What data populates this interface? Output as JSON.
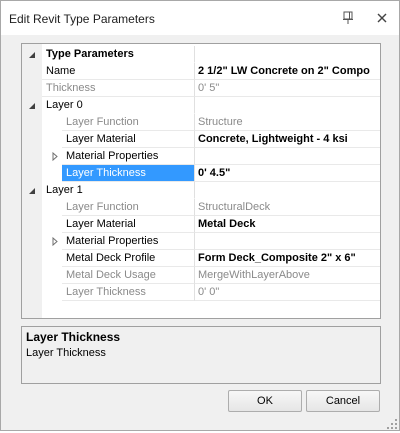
{
  "window": {
    "title": "Edit Revit Type Parameters"
  },
  "titlebar_icons": {
    "pin": "pin-icon",
    "close": "close-icon"
  },
  "icons": {
    "expanded": "triangle-down-icon",
    "collapsed": "triangle-right-icon"
  },
  "colors": {
    "selection": "#3399ff",
    "dim_text": "#8a8a8a"
  },
  "grid": {
    "rows": [
      {
        "kind": "group",
        "label": "Type Parameters",
        "value": "",
        "toggle": "expanded"
      },
      {
        "kind": "prop",
        "label": "Name",
        "value": "2 1/2\" LW Concrete on 2\" Compo",
        "value_bold": true
      },
      {
        "kind": "prop",
        "label": "Thickness",
        "value": "0' 5\"",
        "dim": true
      },
      {
        "kind": "group",
        "label": "Layer 0",
        "value": "",
        "toggle": "expanded",
        "plain": true
      },
      {
        "kind": "sub",
        "label": "Layer Function",
        "value": "Structure",
        "dim": true
      },
      {
        "kind": "sub",
        "label": "Layer Material",
        "value": "Concrete, Lightweight - 4 ksi",
        "value_bold": true
      },
      {
        "kind": "sub",
        "label": "Material Properties",
        "value": "",
        "toggle": "collapsed"
      },
      {
        "kind": "sub",
        "label": "Layer Thickness",
        "value": "0' 4.5\"",
        "value_bold": true,
        "selected": true
      },
      {
        "kind": "group",
        "label": "Layer 1",
        "value": "",
        "toggle": "expanded",
        "plain": true
      },
      {
        "kind": "sub",
        "label": "Layer Function",
        "value": "StructuralDeck",
        "dim": true
      },
      {
        "kind": "sub",
        "label": "Layer Material",
        "value": "Metal Deck",
        "value_bold": true
      },
      {
        "kind": "sub",
        "label": "Material Properties",
        "value": "",
        "toggle": "collapsed"
      },
      {
        "kind": "sub",
        "label": "Metal Deck Profile",
        "value": "Form Deck_Composite 2\" x 6\"",
        "value_bold": true
      },
      {
        "kind": "sub",
        "label": "Metal Deck Usage",
        "value": "MergeWithLayerAbove",
        "dim": true
      },
      {
        "kind": "sub",
        "label": "Layer Thickness",
        "value": "0' 0\"",
        "dim": true
      }
    ]
  },
  "description": {
    "title": "Layer Thickness",
    "body": "Layer Thickness"
  },
  "buttons": {
    "ok": "OK",
    "cancel": "Cancel"
  }
}
